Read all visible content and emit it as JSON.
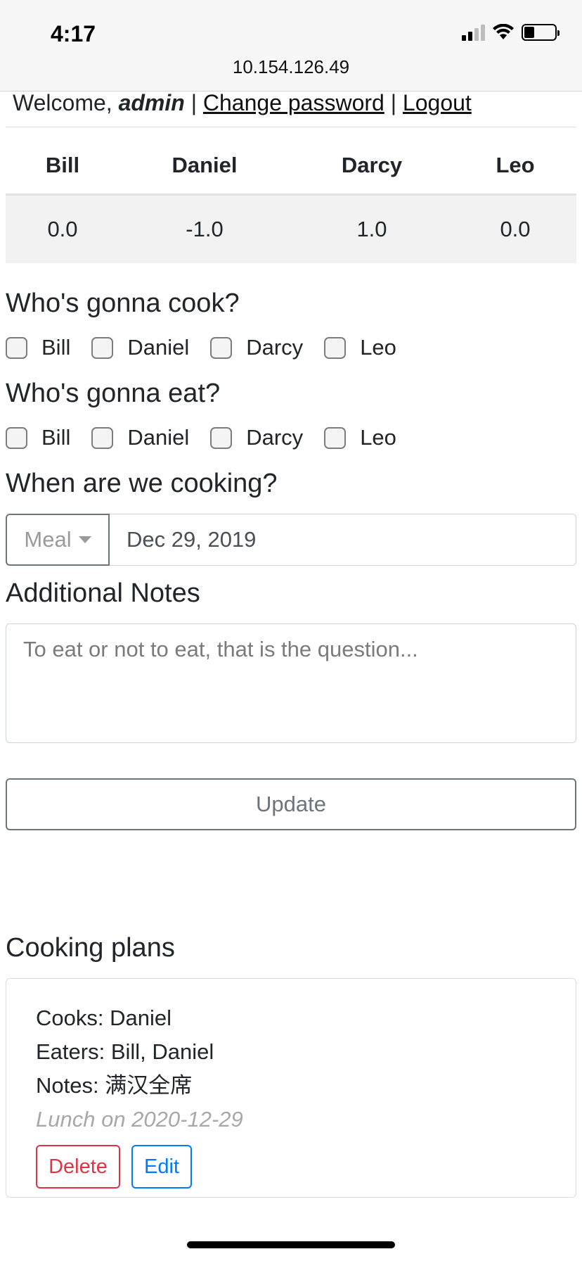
{
  "status_bar": {
    "time": "4:17",
    "signal_bars": 4,
    "signal_bars_filled": 2,
    "battery_level": 0.35
  },
  "browser": {
    "url": "10.154.126.49"
  },
  "header": {
    "welcome_prefix": "Welcome, ",
    "username": "admin",
    "separator": " | ",
    "change_password": "Change password",
    "logout": "Logout"
  },
  "balance": {
    "names": [
      "Bill",
      "Daniel",
      "Darcy",
      "Leo"
    ],
    "values": [
      "0.0",
      "-1.0",
      "1.0",
      "0.0"
    ]
  },
  "cook_section": {
    "title": "Who's gonna cook?",
    "options": [
      "Bill",
      "Daniel",
      "Darcy",
      "Leo"
    ]
  },
  "eat_section": {
    "title": "Who's gonna eat?",
    "options": [
      "Bill",
      "Daniel",
      "Darcy",
      "Leo"
    ]
  },
  "when_section": {
    "title": "When are we cooking?",
    "meal_label": "Meal",
    "date_value": "Dec 29, 2019"
  },
  "notes_section": {
    "title": "Additional Notes",
    "placeholder": "To eat or not to eat, that is the question..."
  },
  "update_button": "Update",
  "plans": {
    "title": "Cooking plans",
    "items": [
      {
        "cooks": "Cooks: Daniel",
        "eaters": "Eaters: Bill, Daniel",
        "notes": "Notes: 满汉全席",
        "when": "Lunch on 2020-12-29",
        "delete_label": "Delete",
        "edit_label": "Edit"
      }
    ]
  }
}
